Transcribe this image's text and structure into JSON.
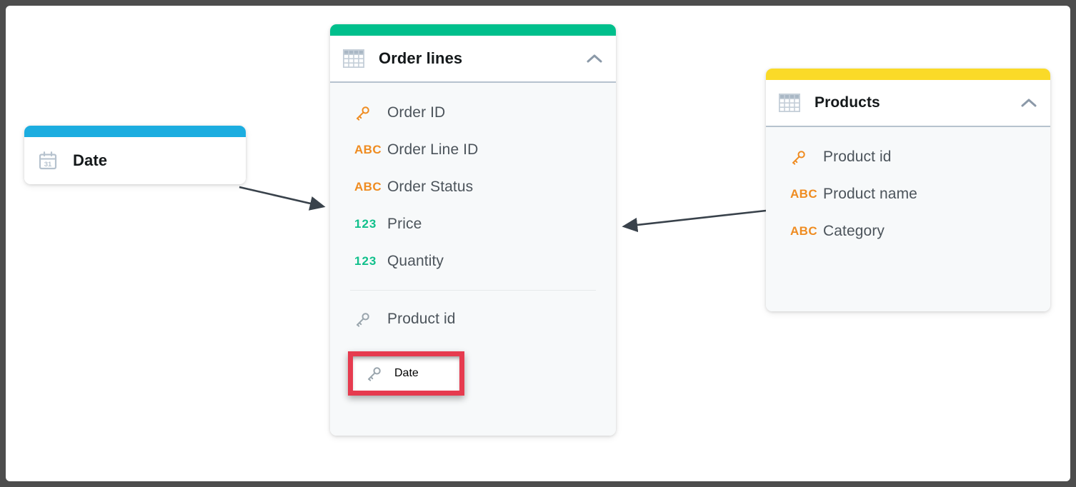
{
  "canvas": {
    "background": "#ffffff",
    "frame_color": "#4d4d4d"
  },
  "palette": {
    "accent_green": "#00bf8c",
    "accent_yellow": "#fada28",
    "accent_blue": "#1cade0",
    "pk_key": "#ef8c21",
    "fk_key": "#9aa5ad",
    "text_type": "#ef8c21",
    "number_type": "#10c08b",
    "label_text": "#4c545b",
    "title_text": "#14181a",
    "highlight_red": "#e63b4f",
    "card_body": "#f7f9fa",
    "header_rule": "#b6c2ce"
  },
  "cards": {
    "date": {
      "title": "Date",
      "accent_color": "#1cade0",
      "table_icon": "calendar-icon",
      "collapse_icon": "none",
      "fields": []
    },
    "order_lines": {
      "title": "Order lines",
      "accent_color": "#00bf8c",
      "table_icon": "table-icon",
      "collapse_icon": "chevron-up-icon",
      "primary_fields": [
        {
          "label": "Order ID",
          "type": "key",
          "icon": "key-icon-primary"
        },
        {
          "label": "Order Line ID",
          "type": "text",
          "icon": "abc-icon"
        },
        {
          "label": "Order Status",
          "type": "text",
          "icon": "abc-icon"
        },
        {
          "label": "Price",
          "type": "number",
          "icon": "123-icon"
        },
        {
          "label": "Quantity",
          "type": "number",
          "icon": "123-icon"
        }
      ],
      "foreign_fields": [
        {
          "label": "Product id",
          "type": "foreign-key",
          "icon": "key-icon-foreign",
          "highlighted": false
        },
        {
          "label": "Date",
          "type": "foreign-key",
          "icon": "key-icon-foreign",
          "highlighted": true
        }
      ]
    },
    "products": {
      "title": "Products",
      "accent_color": "#fada28",
      "table_icon": "table-icon",
      "collapse_icon": "chevron-up-icon",
      "fields": [
        {
          "label": "Product id",
          "type": "key",
          "icon": "key-icon-primary"
        },
        {
          "label": "Product name",
          "type": "text",
          "icon": "abc-icon"
        },
        {
          "label": "Category",
          "type": "text",
          "icon": "abc-icon"
        }
      ]
    }
  },
  "connectors": [
    {
      "name": "date-to-order-lines",
      "from": "date",
      "to": "order_lines",
      "direction": "right"
    },
    {
      "name": "products-to-order-lines",
      "from": "products",
      "to": "order_lines",
      "direction": "left"
    }
  ],
  "icon_glyphs": {
    "abc": "ABC",
    "num": "123",
    "calendar_day": "31"
  }
}
